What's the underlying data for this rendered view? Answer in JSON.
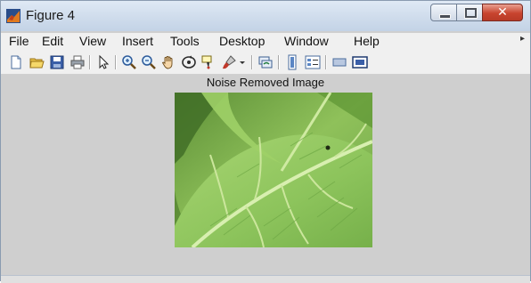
{
  "window": {
    "title": "Figure 4",
    "controls": [
      "minimize-icon",
      "maximize-icon",
      "close-icon"
    ]
  },
  "menu": {
    "items": [
      "File",
      "Edit",
      "View",
      "Insert",
      "Tools",
      "Desktop",
      "Window",
      "Help"
    ]
  },
  "toolbar": {
    "icons": [
      "new-figure-icon",
      "open-file-icon",
      "save-icon",
      "print-icon",
      "edit-plot-arrow-icon",
      "zoom-in-icon",
      "zoom-out-icon",
      "pan-hand-icon",
      "rotate-3d-icon",
      "data-cursor-icon",
      "brush-icon",
      "link-plot-icon",
      "colorbar-icon",
      "legend-icon",
      "hide-plot-tools-icon",
      "show-plot-tools-icon"
    ]
  },
  "figure": {
    "axes_title": "Noise Removed Image",
    "image_subject": "green leaf close-up"
  },
  "colors": {
    "figure_background": "#cfcfcf",
    "menu_background": "#f0f0f0",
    "close_button": "#c8442f"
  }
}
